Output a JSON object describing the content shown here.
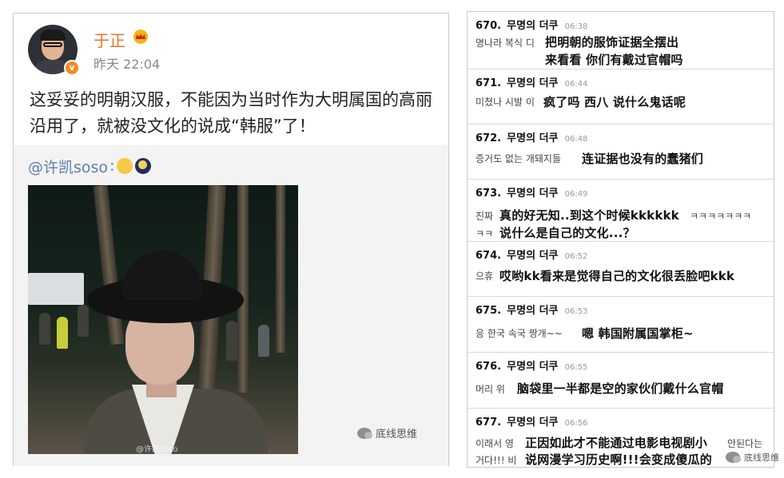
{
  "post": {
    "author": "于正",
    "verified_badge": "v",
    "time": "昨天 22:04",
    "text": "这妥妥的明朝汉服，不能因为当时作为大明属国的高丽沿用了，就被没文化的说成“韩服”了！",
    "repost": {
      "mention": "@许凯soso",
      "colon": ":",
      "emoji": [
        "thinking-emoji",
        "moon-emoji"
      ],
      "photo_watermark": "@许凯soso"
    },
    "watermark": "底线思维",
    "colors": {
      "author": "#e8762d",
      "mention": "#5d7fb0",
      "vip": "#f5b41a"
    }
  },
  "comments": [
    {
      "num": "670.",
      "nick": "무명의 더쿠",
      "time": "06:38",
      "ko": [
        "명나라 복식 디"
      ],
      "cn": [
        "把明朝的服饰证据全摆出",
        "来看看 你们有戴过官帽吗"
      ]
    },
    {
      "num": "671.",
      "nick": "무명의 더쿠",
      "time": "06:44",
      "ko": [
        "미쳤나 시발 이"
      ],
      "cn": [
        "疯了吗 西八 说什么鬼话呢"
      ]
    },
    {
      "num": "672.",
      "nick": "무명의 더쿠",
      "time": "06:48",
      "ko": [
        "증거도 없는 개돼지들"
      ],
      "cn": [
        "连证据也没有的蠢猪们"
      ]
    },
    {
      "num": "673.",
      "nick": "무명의 더쿠",
      "time": "06:49",
      "ko": [
        "진짜",
        "ㅋㅋ"
      ],
      "cn": [
        "真的好无知..到这个时候kkkkkk",
        "说什么是自己的文化...？"
      ],
      "ko_tail": "ㅋㅋㅋㅋㅋㅋㅋ"
    },
    {
      "num": "674.",
      "nick": "무명의 더쿠",
      "time": "06:52",
      "ko": [
        "으휴"
      ],
      "cn": [
        "哎哟kk看来是觉得自己的文化很丢脸吧kkk"
      ]
    },
    {
      "num": "675.",
      "nick": "무명의 더쿠",
      "time": "06:53",
      "ko": [
        "응 한국 속국 짱개~~"
      ],
      "cn": [
        "嗯 韩国附属国掌柜~"
      ]
    },
    {
      "num": "676.",
      "nick": "무명의 더쿠",
      "time": "06:55",
      "ko": [
        "머리 위"
      ],
      "cn": [
        "脑袋里一半都是空的家伙们戴什么官帽"
      ]
    },
    {
      "num": "677.",
      "nick": "무명의 더쿠",
      "time": "06:56",
      "ko": [
        "이래서 영",
        "거다!!! 비"
      ],
      "cn": [
        "正因如此才不能通过电影电视剧小",
        "说网漫学习历史啊!!!会变成傻瓜的"
      ],
      "ko_tail": "안된다는"
    }
  ],
  "right_watermark": "底线思维"
}
